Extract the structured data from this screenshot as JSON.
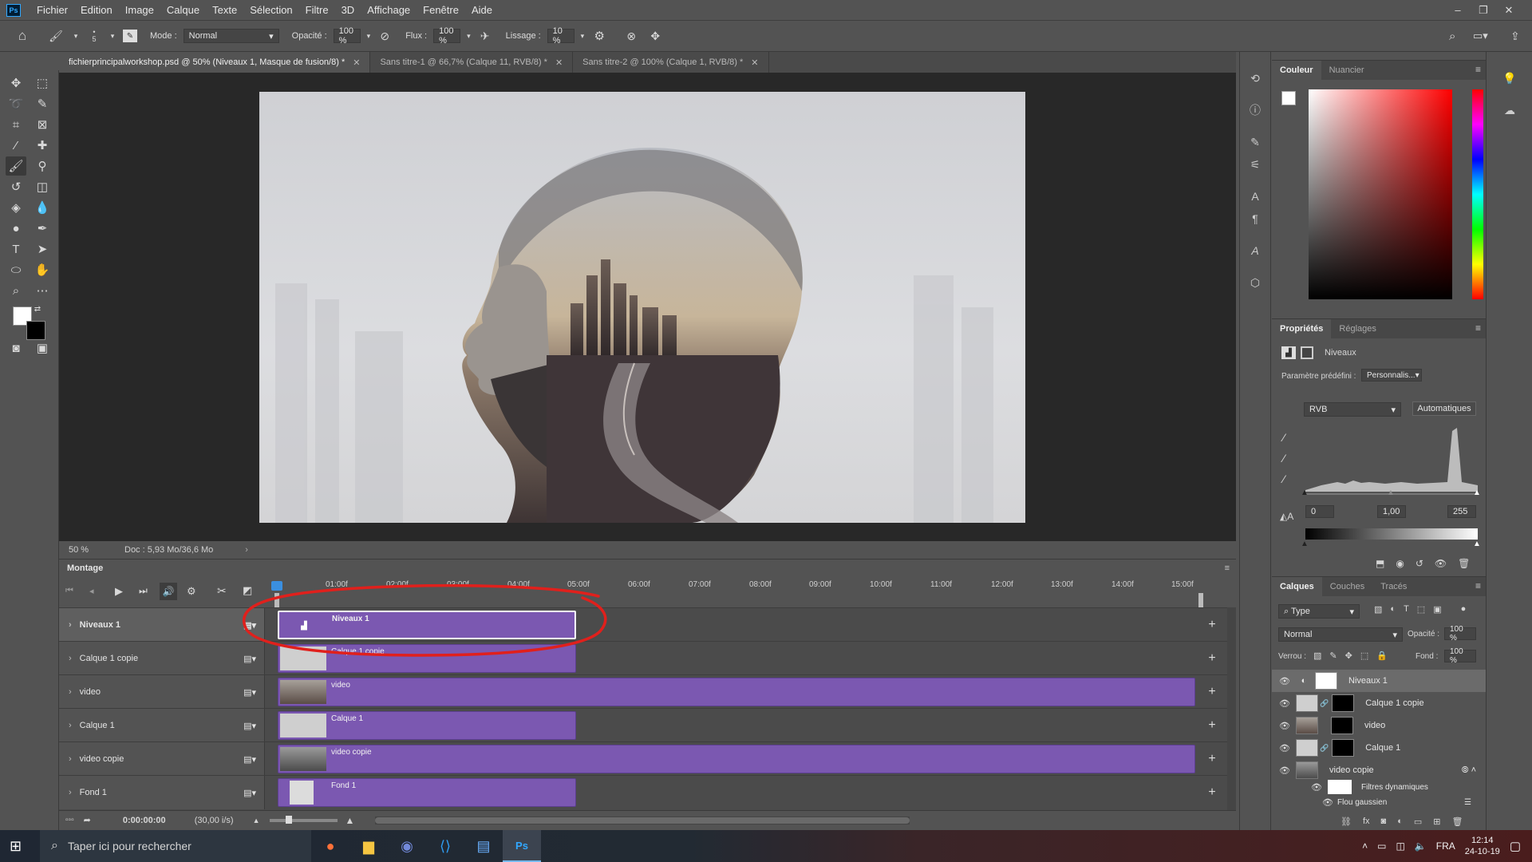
{
  "menubar": {
    "logo": "Ps",
    "items": [
      "Fichier",
      "Edition",
      "Image",
      "Calque",
      "Texte",
      "Sélection",
      "Filtre",
      "3D",
      "Affichage",
      "Fenêtre",
      "Aide"
    ]
  },
  "options": {
    "brush_size": "5",
    "mode_label": "Mode :",
    "mode_value": "Normal",
    "opacity_label": "Opacité :",
    "opacity_value": "100 %",
    "flux_label": "Flux :",
    "flux_value": "100 %",
    "lissage_label": "Lissage :",
    "lissage_value": "10 %"
  },
  "tabs": [
    {
      "label": "fichierprincipalworkshop.psd @ 50% (Niveaux 1, Masque de fusion/8) *"
    },
    {
      "label": "Sans titre-1 @ 66,7% (Calque 11, RVB/8) *"
    },
    {
      "label": "Sans titre-2 @ 100% (Calque 1, RVB/8) *"
    }
  ],
  "status": {
    "zoom": "50 %",
    "doc": "Doc : 5,93 Mo/36,6 Mo"
  },
  "timeline": {
    "title": "Montage",
    "ticks": [
      "01:00f",
      "02:00f",
      "03:00f",
      "04:00f",
      "05:00f",
      "06:00f",
      "07:00f",
      "08:00f",
      "09:00f",
      "10:00f",
      "11:00f",
      "12:00f",
      "13:00f",
      "14:00f",
      "15:00f"
    ],
    "tracks": [
      {
        "name": "Niveaux 1",
        "clip": "Niveaux 1"
      },
      {
        "name": "Calque 1 copie",
        "clip": "Calque 1 copie"
      },
      {
        "name": "video",
        "clip": "video"
      },
      {
        "name": "Calque 1",
        "clip": "Calque 1"
      },
      {
        "name": "video copie",
        "clip": "video copie"
      },
      {
        "name": "Fond 1",
        "clip": "Fond 1"
      }
    ],
    "timecode": "0:00:00:00",
    "fps": "(30,00 i/s)"
  },
  "color_panel": {
    "tabs": [
      "Couleur",
      "Nuancier"
    ]
  },
  "properties": {
    "tabs": [
      "Propriétés",
      "Réglages"
    ],
    "type": "Niveaux",
    "preset_label": "Paramètre prédéfini :",
    "preset_value": "Personnalis...",
    "channel": "RVB",
    "auto_button": "Automatiques",
    "input_black": "0",
    "input_gamma": "1,00",
    "input_white": "255"
  },
  "layers_panel": {
    "tabs": [
      "Calques",
      "Couches",
      "Tracés"
    ],
    "filter": "Type",
    "blend": "Normal",
    "opacity_label": "Opacité :",
    "opacity_value": "100 %",
    "lock_label": "Verrou :",
    "fill_label": "Fond :",
    "fill_value": "100 %",
    "layers": [
      {
        "name": "Niveaux 1"
      },
      {
        "name": "Calque 1 copie"
      },
      {
        "name": "video"
      },
      {
        "name": "Calque 1"
      },
      {
        "name": "video copie"
      },
      {
        "name": "Filtres dynamiques"
      },
      {
        "name": "Flou gaussien"
      }
    ]
  },
  "taskbar": {
    "search_placeholder": "Taper ici pour rechercher",
    "lang": "FRA",
    "time": "12:14",
    "date": "24-10-19"
  },
  "colors": {
    "clip": "#7b58b1",
    "annotation": "#e0201c"
  }
}
